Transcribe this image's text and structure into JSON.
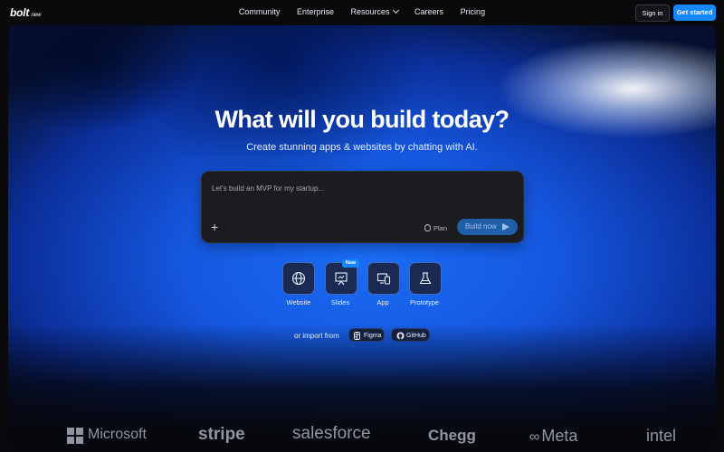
{
  "nav": {
    "logo": "bolt",
    "logo_suffix": ".new",
    "links": [
      "Community",
      "Enterprise",
      "Resources",
      "Careers",
      "Pricing"
    ],
    "signin": "Sign in",
    "get_started": "Get started"
  },
  "hero": {
    "title": "What will you build today?",
    "subtitle": "Create stunning apps & websites by chatting with AI."
  },
  "prompt": {
    "placeholder": "Let's build an MVP for my startup...",
    "plan_label": "Plan",
    "build_label": "Build now"
  },
  "modes": [
    {
      "label": "Website",
      "icon": "globe-icon"
    },
    {
      "label": "Slides",
      "icon": "presentation-icon",
      "badge": "New"
    },
    {
      "label": "App",
      "icon": "devices-icon"
    },
    {
      "label": "Prototype",
      "icon": "flask-icon"
    }
  ],
  "import": {
    "label": "or import from",
    "figma": "Figma",
    "github": "GitHub"
  },
  "logos": [
    "Microsoft",
    "stripe",
    "salesforce",
    "Chegg",
    "Meta",
    "intel"
  ],
  "colors": {
    "accent": "#1488fc",
    "build_button": "#1f5fa8",
    "prompt_bg": "#1b1c20"
  }
}
